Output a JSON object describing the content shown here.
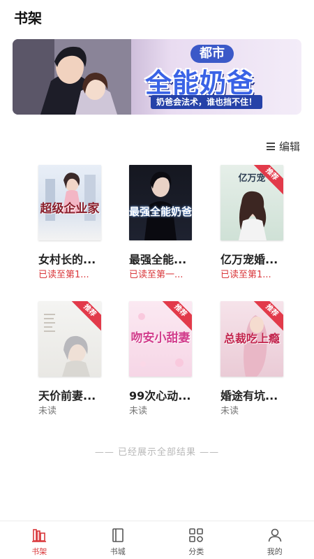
{
  "header": {
    "title": "书架"
  },
  "banner": {
    "tag": "都市",
    "title": "全能奶爸",
    "slogan": "奶爸会法术，谁也挡不住！"
  },
  "edit": {
    "label": "编辑"
  },
  "books": [
    {
      "title": "女村长的...",
      "status": "已读至第1...",
      "status_color": "red",
      "cover_text": "超级企业家",
      "badge": ""
    },
    {
      "title": "最强全能...",
      "status": "已读至第一...",
      "status_color": "red",
      "cover_text": "最强全能奶爸",
      "badge": ""
    },
    {
      "title": "亿万宠婚...",
      "status": "已读至第1...",
      "status_color": "red",
      "cover_text": "亿万宠",
      "badge": "推荐"
    },
    {
      "title": "天价前妻...",
      "status": "未读",
      "status_color": "grey",
      "cover_text": "",
      "badge": "推荐"
    },
    {
      "title": "99次心动...",
      "status": "未读",
      "status_color": "grey",
      "cover_text": "吻安小甜妻",
      "badge": "推荐"
    },
    {
      "title": "婚途有坑...",
      "status": "未读",
      "status_color": "grey",
      "cover_text": "总裁吃上瘾",
      "badge": "推荐"
    }
  ],
  "footer_note": "—— 已经展示全部结果 ——",
  "tabs": [
    {
      "label": "书架",
      "icon": "bookshelf-icon",
      "active": true
    },
    {
      "label": "书城",
      "icon": "book-icon",
      "active": false
    },
    {
      "label": "分类",
      "icon": "grid-icon",
      "active": false
    },
    {
      "label": "我的",
      "icon": "person-icon",
      "active": false
    }
  ],
  "colors": {
    "accent": "#d9373a",
    "banner_blue": "#3a63e6"
  }
}
